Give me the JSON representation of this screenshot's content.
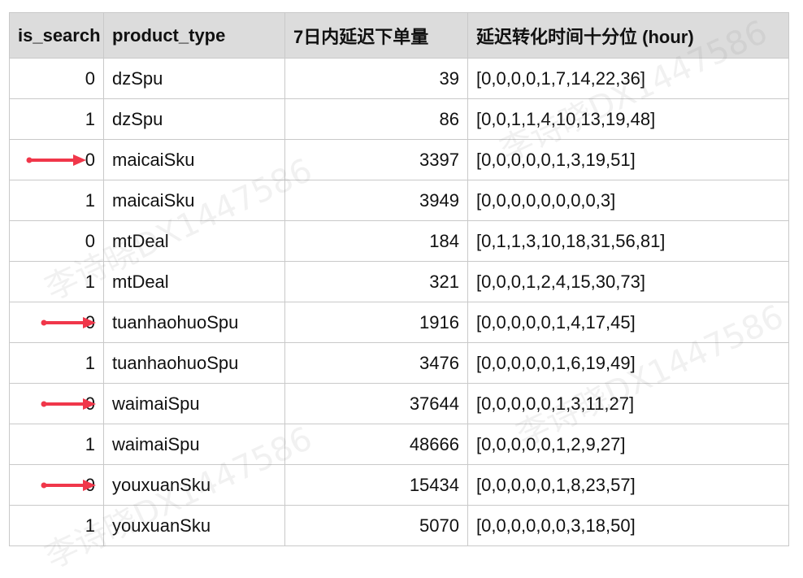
{
  "table": {
    "headers": {
      "is_search": "is_search",
      "product_type": "product_type",
      "count": "7日内延迟下单量",
      "conversion": "延迟转化时间十分位 (hour)"
    },
    "rows": [
      {
        "is_search": "0",
        "product_type": "dzSpu",
        "count": "39",
        "conversion": "[0,0,0,0,1,7,14,22,36]",
        "arrow": false
      },
      {
        "is_search": "1",
        "product_type": "dzSpu",
        "count": "86",
        "conversion": "[0,0,1,1,4,10,13,19,48]",
        "arrow": false
      },
      {
        "is_search": "0",
        "product_type": "maicaiSku",
        "count": "3397",
        "conversion": "[0,0,0,0,0,1,3,19,51]",
        "arrow": true
      },
      {
        "is_search": "1",
        "product_type": "maicaiSku",
        "count": "3949",
        "conversion": "[0,0,0,0,0,0,0,0,3]",
        "arrow": false
      },
      {
        "is_search": "0",
        "product_type": "mtDeal",
        "count": "184",
        "conversion": "[0,1,1,3,10,18,31,56,81]",
        "arrow": false
      },
      {
        "is_search": "1",
        "product_type": "mtDeal",
        "count": "321",
        "conversion": "[0,0,0,1,2,4,15,30,73]",
        "arrow": false
      },
      {
        "is_search": "0",
        "product_type": "tuanhaohuoSpu",
        "count": "1916",
        "conversion": "[0,0,0,0,0,1,4,17,45]",
        "arrow": true
      },
      {
        "is_search": "1",
        "product_type": "tuanhaohuoSpu",
        "count": "3476",
        "conversion": "[0,0,0,0,0,1,6,19,49]",
        "arrow": false
      },
      {
        "is_search": "0",
        "product_type": "waimaiSpu",
        "count": "37644",
        "conversion": "[0,0,0,0,0,1,3,11,27]",
        "arrow": true
      },
      {
        "is_search": "1",
        "product_type": "waimaiSpu",
        "count": "48666",
        "conversion": "[0,0,0,0,0,1,2,9,27]",
        "arrow": false
      },
      {
        "is_search": "0",
        "product_type": "youxuanSku",
        "count": "15434",
        "conversion": "[0,0,0,0,0,1,8,23,57]",
        "arrow": true
      },
      {
        "is_search": "1",
        "product_type": "youxuanSku",
        "count": "5070",
        "conversion": "[0,0,0,0,0,0,3,18,50]",
        "arrow": false
      }
    ]
  },
  "colors": {
    "arrow": "#f0374a",
    "header_bg": "#dcdcdc",
    "border": "#c9c9c9"
  },
  "watermark": {
    "text": "李诗晓DX1447586"
  }
}
